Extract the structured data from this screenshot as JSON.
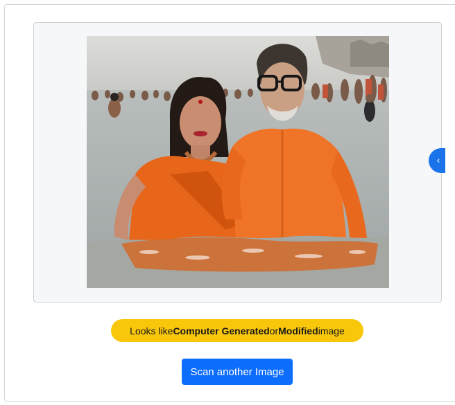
{
  "result": {
    "prefix": "Looks like ",
    "term_1": "Computer Generated",
    "middle": " or ",
    "term_2": "Modified",
    "suffix": " image"
  },
  "actions": {
    "scan_label": "Scan another Image"
  },
  "icons": {
    "collapse": "chevron-left-icon"
  },
  "colors": {
    "badge": "#f8c60a",
    "button": "#0d6efd",
    "tab": "#1a73e8"
  }
}
